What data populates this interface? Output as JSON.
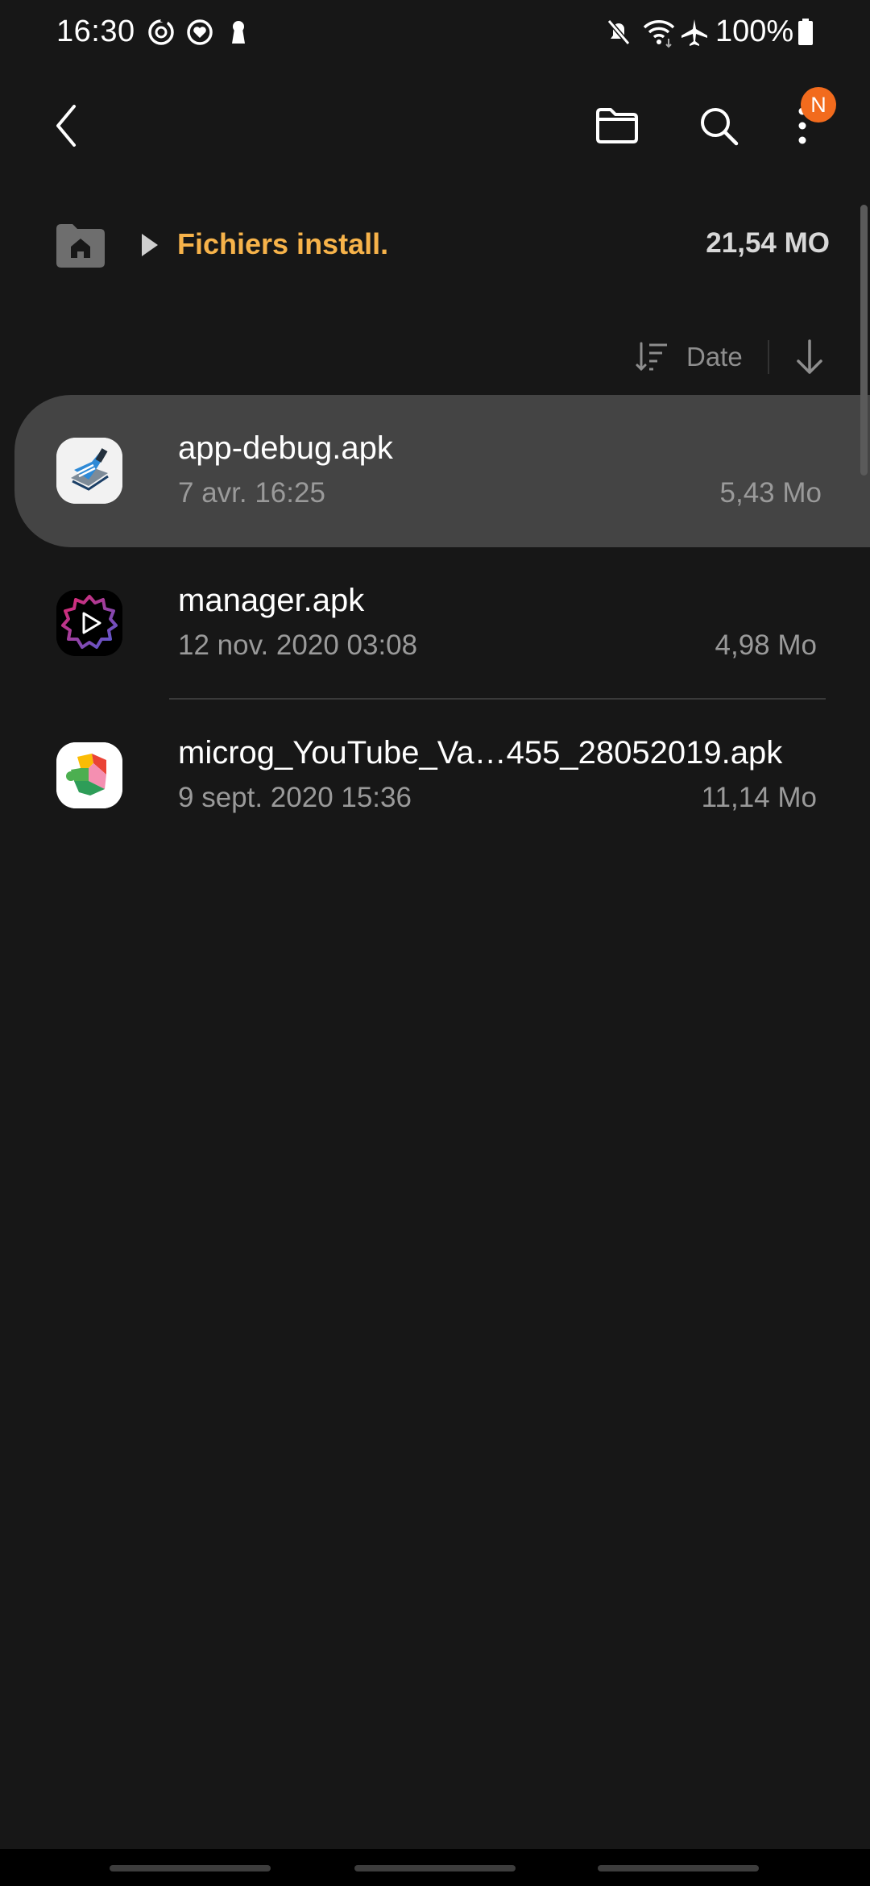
{
  "status_bar": {
    "time": "16:30",
    "battery": "100%",
    "icons": [
      "sync-icon",
      "health-icon",
      "keyhole-icon",
      "mute-icon",
      "wifi-icon",
      "airplane-icon",
      "battery-icon"
    ]
  },
  "toolbar": {
    "back_icon": "back-icon",
    "folder_icon": "folder-icon",
    "search_icon": "search-icon",
    "more_icon": "more-icon",
    "badge": "N",
    "badge_color": "#f26b1d"
  },
  "path": {
    "label": "Fichiers install.",
    "size": "21,54 MO",
    "accent": "#f7b34a"
  },
  "sort": {
    "label": "Date"
  },
  "files": [
    {
      "name": "app-debug.apk",
      "date": "7 avr. 16:25",
      "size": "5,43 Mo",
      "selected": true
    },
    {
      "name": "manager.apk",
      "date": "12 nov. 2020 03:08",
      "size": "4,98 Mo",
      "selected": false
    },
    {
      "name": "microg_YouTube_Va…455_28052019.apk",
      "date": "9 sept. 2020 15:36",
      "size": "11,14 Mo",
      "selected": false
    }
  ]
}
